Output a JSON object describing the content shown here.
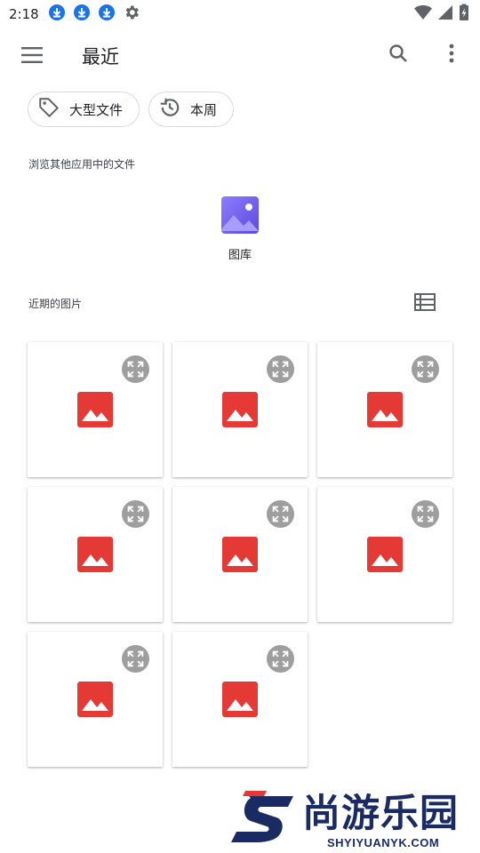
{
  "status_bar": {
    "time": "2:18",
    "icons": [
      "download-icon",
      "download-icon",
      "download-icon",
      "settings-icon"
    ],
    "right_icons": [
      "wifi-icon",
      "signal-icon",
      "battery-charging-icon"
    ],
    "download_badge_color": "#1a73e8"
  },
  "app_bar": {
    "title": "最近",
    "menu_icon": "hamburger-menu-icon",
    "search_icon": "search-icon",
    "more_icon": "more-vertical-icon"
  },
  "chips": [
    {
      "label": "大型文件",
      "icon": "tag-icon"
    },
    {
      "label": "本周",
      "icon": "history-icon"
    }
  ],
  "browse_section": {
    "label": "浏览其他应用中的文件",
    "apps": [
      {
        "label": "图库",
        "icon": "gallery-app-icon",
        "color": "#7b61ff"
      }
    ]
  },
  "recent_section": {
    "label": "近期的图片",
    "view_toggle_icon": "list-view-icon",
    "items": [
      {
        "icon": "image-icon"
      },
      {
        "icon": "image-icon"
      },
      {
        "icon": "image-icon"
      },
      {
        "icon": "image-icon"
      },
      {
        "icon": "image-icon"
      },
      {
        "icon": "image-icon"
      },
      {
        "icon": "image-icon"
      },
      {
        "icon": "image-icon"
      }
    ],
    "image_icon_color": "#e53935",
    "expand_icon": "expand-icon"
  },
  "watermark": {
    "brand": "尚游乐园",
    "url": "SHYIYUANYK.COM",
    "color": "#1a2a63",
    "accent": "#e53935"
  }
}
